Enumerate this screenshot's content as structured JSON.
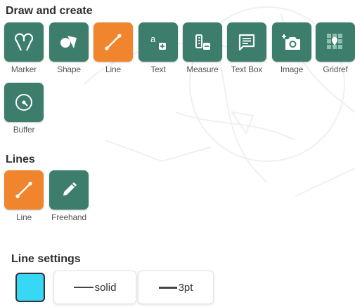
{
  "sections": {
    "draw_create": "Draw and create",
    "lines": "Lines",
    "line_settings": "Line settings"
  },
  "tools": [
    {
      "label": "Marker",
      "icon": "marker-icon"
    },
    {
      "label": "Shape",
      "icon": "shape-icon"
    },
    {
      "label": "Line",
      "icon": "line-icon",
      "active": true
    },
    {
      "label": "Text",
      "icon": "text-icon"
    },
    {
      "label": "Measure",
      "icon": "measure-icon"
    },
    {
      "label": "Text Box",
      "icon": "text-box-icon"
    },
    {
      "label": "Image",
      "icon": "add-image-icon"
    },
    {
      "label": "Gridref",
      "icon": "gridref-icon"
    },
    {
      "label": "Buffer",
      "icon": "buffer-icon"
    }
  ],
  "line_tools": [
    {
      "label": "Line",
      "icon": "line-icon",
      "active": true
    },
    {
      "label": "Freehand",
      "icon": "pencil-icon"
    }
  ],
  "settings": {
    "color": "#37d8f5",
    "style_label": "solid",
    "width_label": "3pt"
  },
  "colors": {
    "tool_bg": "#3c7d6b",
    "active_bg": "#f0852d"
  }
}
